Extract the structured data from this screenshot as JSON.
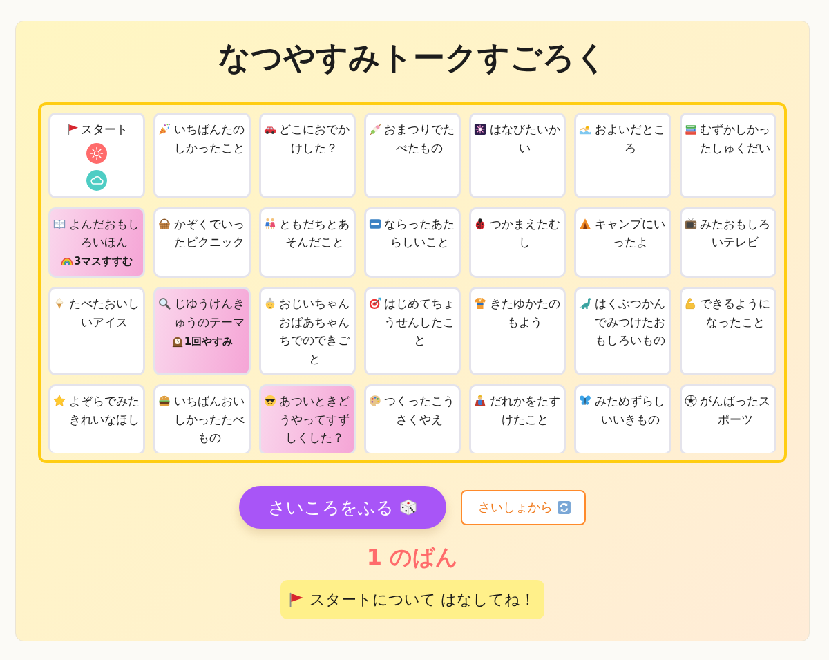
{
  "title": "なつやすみトークすごろく",
  "board": {
    "cells": [
      {
        "label": "スタート",
        "kind": "plain",
        "tokens": [
          {
            "color": "#ff6b6b"
          },
          {
            "color": "#4ecdc4"
          }
        ]
      },
      {
        "label": "いちばんたのしかったこと",
        "kind": "plain"
      },
      {
        "label": "どこにおでかけした？",
        "kind": "plain"
      },
      {
        "label": "おまつりでたべたもの",
        "kind": "plain"
      },
      {
        "label": "はなびたいかい",
        "kind": "plain"
      },
      {
        "label": "およいだところ",
        "kind": "plain"
      },
      {
        "label": "むずかしかったしゅくだい",
        "kind": "plain"
      },
      {
        "label": "よんだおもしろいほん",
        "kind": "event",
        "event": "3マスすすむ"
      },
      {
        "label": "かぞくでいったピクニック",
        "kind": "plain"
      },
      {
        "label": "ともだちとあそんだこと",
        "kind": "plain"
      },
      {
        "label": "ならったあたらしいこと",
        "kind": "plain"
      },
      {
        "label": "つかまえたむし",
        "kind": "plain"
      },
      {
        "label": "キャンプにいったよ",
        "kind": "plain"
      },
      {
        "label": "みたおもしろいテレビ",
        "kind": "plain"
      },
      {
        "label": "たべたおいしいアイス",
        "kind": "plain"
      },
      {
        "label": "じゆうけんきゅうのテーマ",
        "kind": "event",
        "event": "1回やすみ"
      },
      {
        "label": "おじいちゃんおばあちゃんちでのできごと",
        "kind": "plain"
      },
      {
        "label": "はじめてちょうせんしたこと",
        "kind": "plain"
      },
      {
        "label": "きたゆかたのもよう",
        "kind": "plain"
      },
      {
        "label": "はくぶつかんでみつけたおもしろいもの",
        "kind": "plain"
      },
      {
        "label": "できるようになったこと",
        "kind": "plain"
      },
      {
        "label": "よぞらでみたきれいなほし",
        "kind": "plain"
      },
      {
        "label": "いちばんおいしかったたべもの",
        "kind": "plain"
      },
      {
        "label": "あついときどうやってすずしくした？",
        "kind": "event"
      },
      {
        "label": "つくったこうさくやえ",
        "kind": "plain"
      },
      {
        "label": "だれかをたすけたこと",
        "kind": "plain"
      },
      {
        "label": "みためずらしいいきもの",
        "kind": "plain"
      },
      {
        "label": "がんばったスポーツ",
        "kind": "plain"
      }
    ]
  },
  "buttons": [
    {
      "label": "さいころをふる",
      "kind": "primary"
    },
    {
      "label": "さいしょから",
      "kind": "outline"
    }
  ],
  "turn": "1 のばん",
  "message": "スタートについて はなしてね！"
}
